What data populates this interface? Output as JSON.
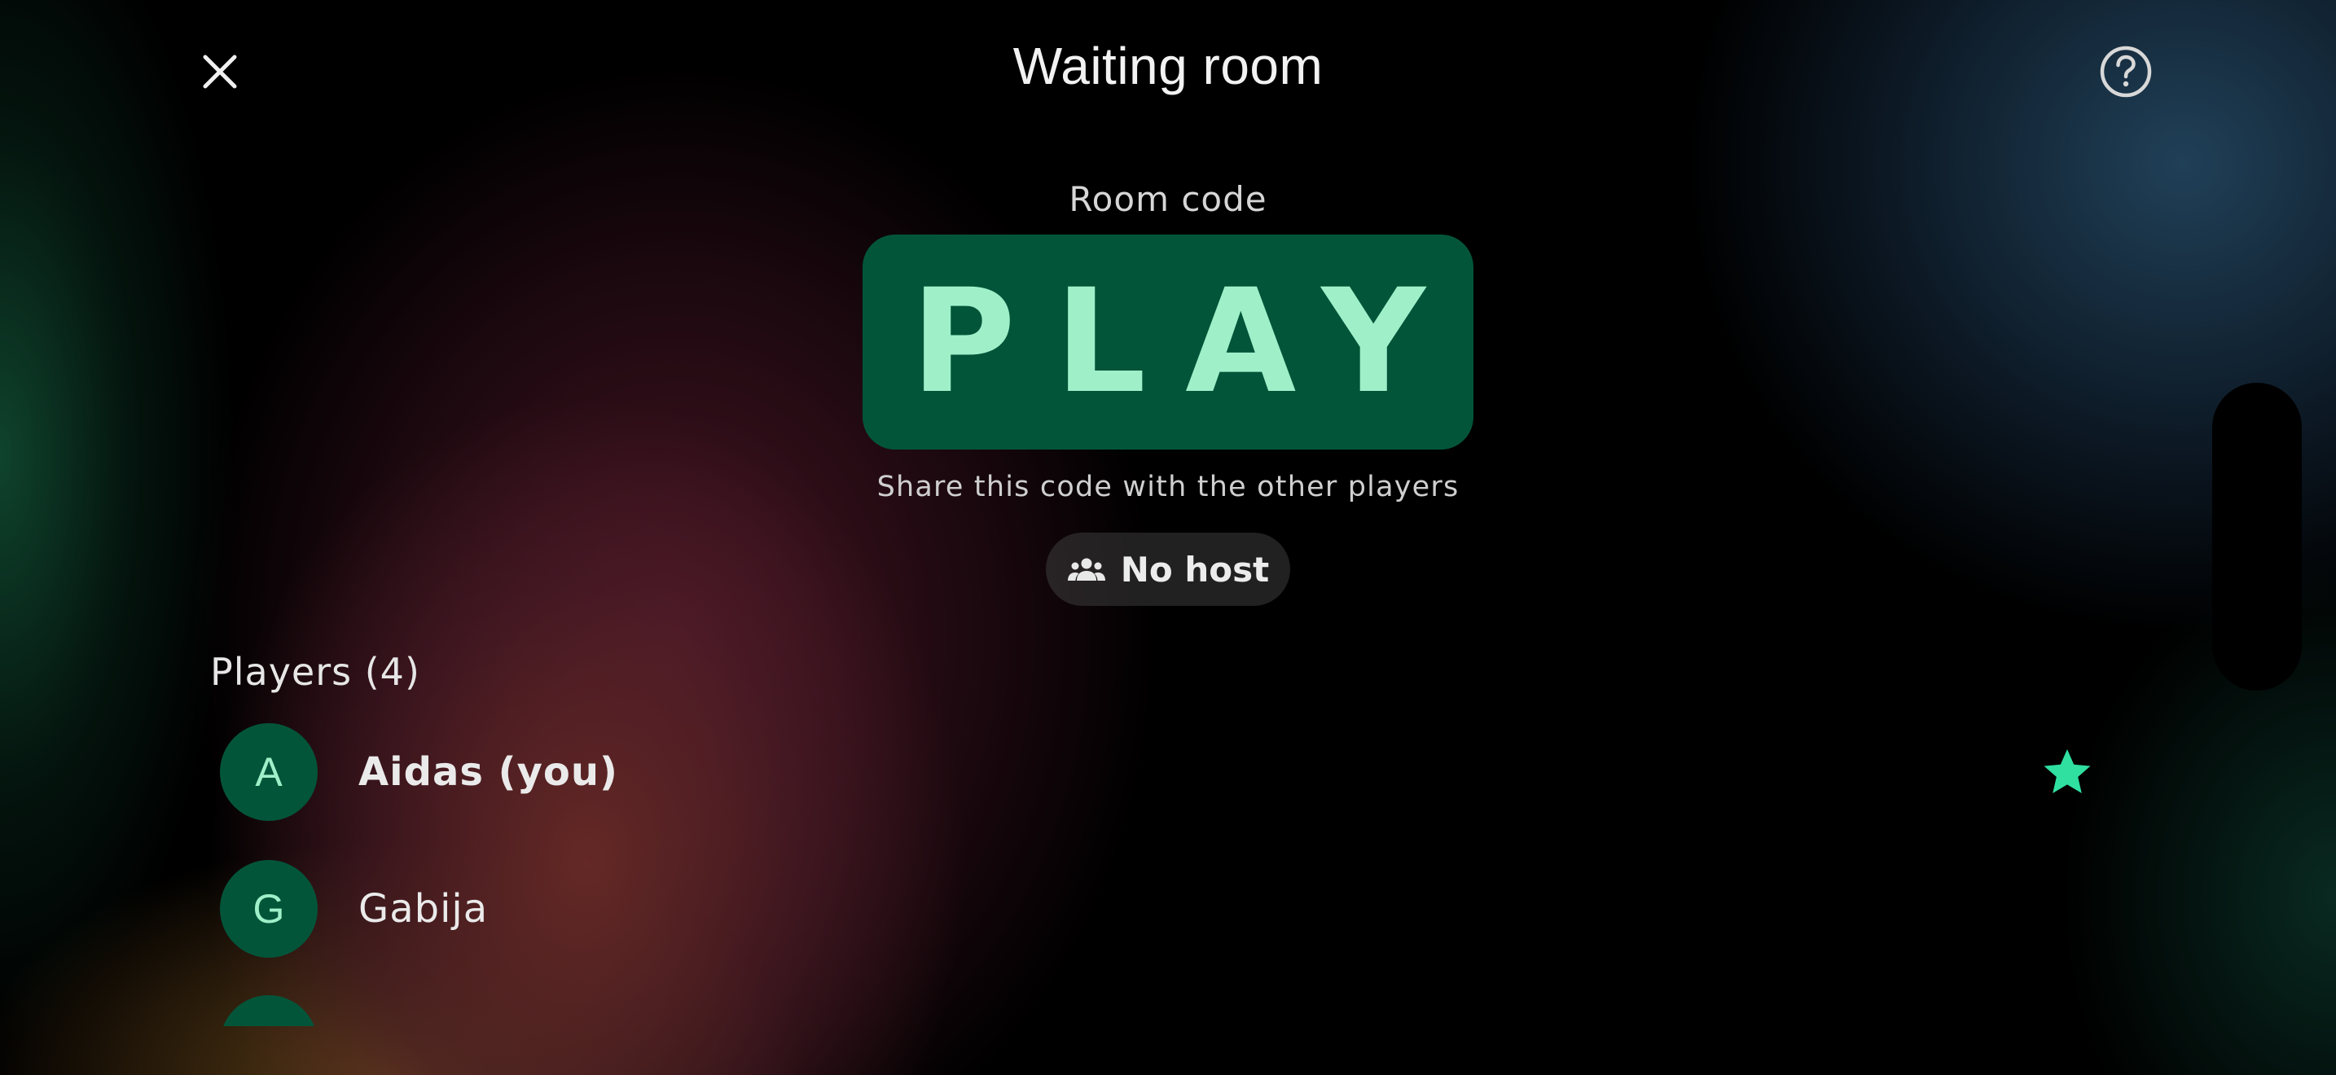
{
  "header": {
    "title": "Waiting room",
    "close_icon": "close-icon",
    "help_icon": "help-circle-icon"
  },
  "room": {
    "label": "Room code",
    "code": "PLAY",
    "share_hint": "Share this code with the other players"
  },
  "host_chip": {
    "icon": "group-icon",
    "label": "No host"
  },
  "players": {
    "heading": "Players (4)",
    "items": [
      {
        "initial": "A",
        "name": "Aidas (you)",
        "is_you": true,
        "badge_icon": "star-icon"
      },
      {
        "initial": "G",
        "name": "Gabija",
        "is_you": false
      }
    ]
  },
  "colors": {
    "accent_dark": "#03553a",
    "accent_light": "#9ff0c9",
    "star": "#2fe0a0"
  }
}
